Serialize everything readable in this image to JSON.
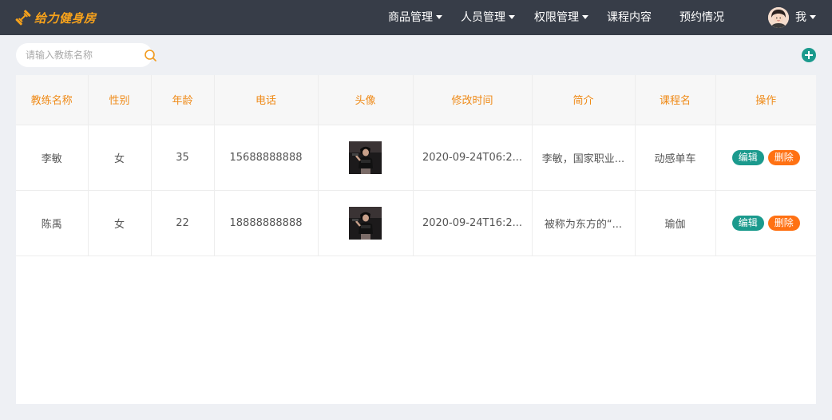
{
  "header": {
    "logo_text": "给力健身房",
    "nav": [
      {
        "label": "商品管理",
        "dropdown": true
      },
      {
        "label": "人员管理",
        "dropdown": true
      },
      {
        "label": "权限管理",
        "dropdown": true
      },
      {
        "label": "课程内容",
        "dropdown": false
      },
      {
        "label": "预约情况",
        "dropdown": false
      }
    ],
    "user_label": "我"
  },
  "search": {
    "placeholder": "请输入教练名称",
    "value": ""
  },
  "table": {
    "columns": [
      "教练名称",
      "性别",
      "年龄",
      "电话",
      "头像",
      "修改时间",
      "简介",
      "课程名",
      "操作"
    ],
    "rows": [
      {
        "name": "李敏",
        "gender": "女",
        "age": "35",
        "phone": "15688888888",
        "updated": "2020-09-24T06:2...",
        "intro": "李敏，国家职业...",
        "course": "动感单车"
      },
      {
        "name": "陈禹",
        "gender": "女",
        "age": "22",
        "phone": "18888888888",
        "updated": "2020-09-24T16:2...",
        "intro": "被称为东方的“...",
        "course": "瑜伽"
      }
    ],
    "actions": {
      "edit": "编辑",
      "delete": "删除"
    }
  },
  "colors": {
    "header_bg": "#373d48",
    "accent_orange": "#ef8a17",
    "edit_button": "#1b9a8d",
    "delete_button": "#ff7113",
    "add_icon": "#1b9a8d"
  },
  "icons": [
    "dumbbell-logo-icon",
    "caret-down-icon",
    "user-avatar",
    "search-icon",
    "add-circle-icon",
    "coach-photo"
  ]
}
